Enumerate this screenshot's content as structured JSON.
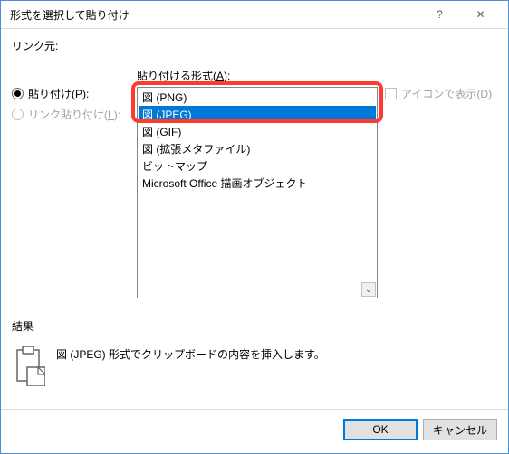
{
  "title": "形式を選択して貼り付け",
  "source_label": "リンク元:",
  "radios": {
    "paste_label": "貼り付け(P):",
    "paste_link_label": "リンク貼り付け(L):"
  },
  "list_label": "貼り付ける形式(A):",
  "items": [
    "図 (PNG)",
    "図 (JPEG)",
    "図 (GIF)",
    "図 (拡張メタファイル)",
    "ビットマップ",
    "Microsoft Office 描画オブジェクト"
  ],
  "icon_checkbox_label": "アイコンで表示(D)",
  "result_label": "結果",
  "result_text": "図 (JPEG) 形式でクリップボードの内容を挿入します。",
  "buttons": {
    "ok": "OK",
    "cancel": "キャンセル"
  },
  "help_glyph": "?",
  "close_glyph": "✕",
  "scroll_glyph": "⌄"
}
